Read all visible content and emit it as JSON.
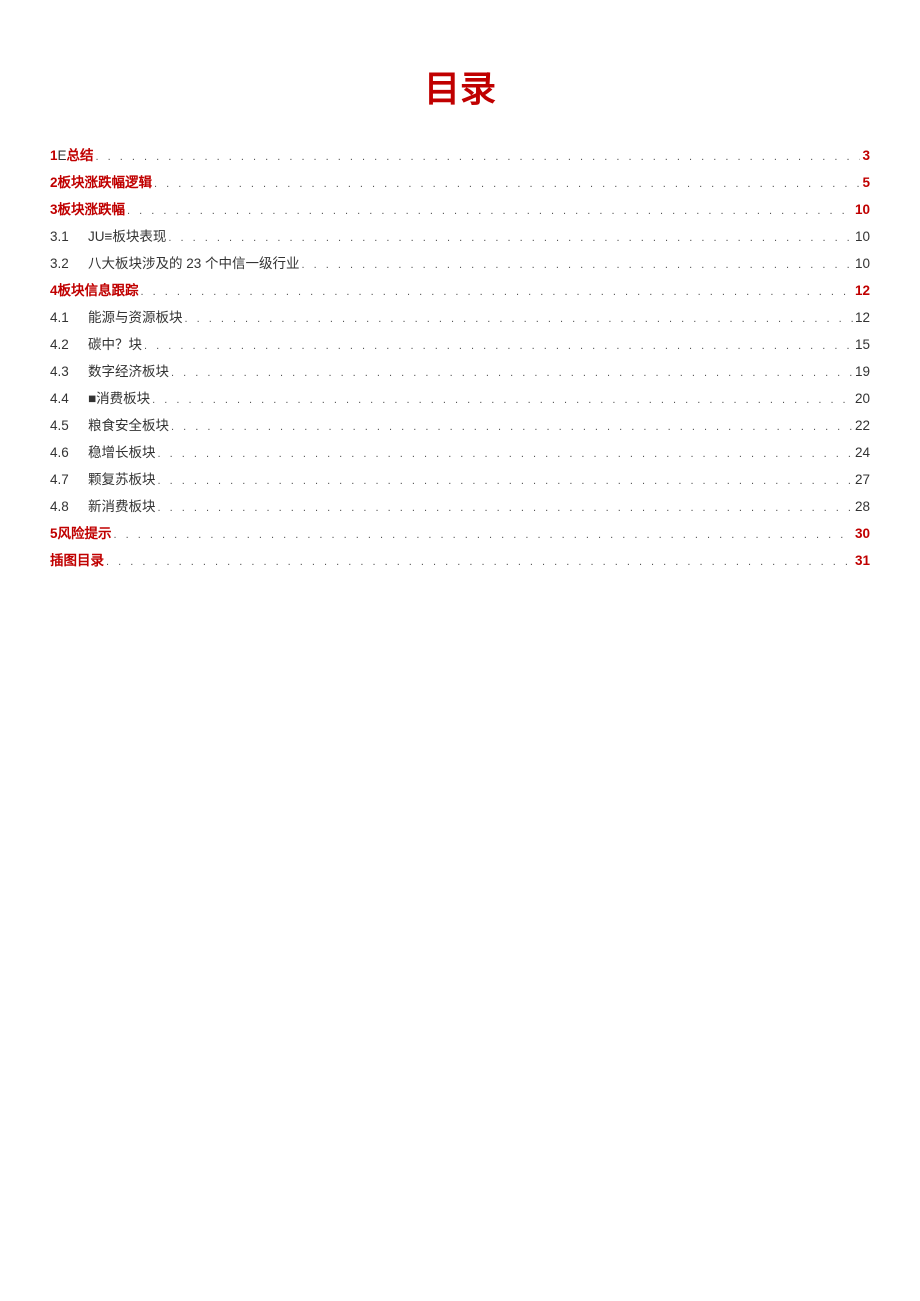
{
  "title": "目录",
  "colors": {
    "accent": "#c00000",
    "text": "#333333"
  },
  "entries": [
    {
      "level": 1,
      "num": "1",
      "numSuffix": "E",
      "text": " 总结",
      "page": "3",
      "accent": true
    },
    {
      "level": 1,
      "num": "2",
      "text": " 板块涨跌幅逻辑",
      "page": "5",
      "accent": true
    },
    {
      "level": 1,
      "num": "3",
      "text": " 板块涨跌幅",
      "page": "10",
      "accent": true
    },
    {
      "level": 2,
      "num": "3.1",
      "text": "JU≡板块表现",
      "page": "10",
      "accent": false
    },
    {
      "level": 2,
      "num": "3.2",
      "text": "八大板块涉及的 23 个中信一级行业",
      "page": "10",
      "accent": false
    },
    {
      "level": 1,
      "num": "4",
      "text": " 板块信息跟踪",
      "page": "12",
      "accent": true
    },
    {
      "level": 2,
      "num": "4.1",
      "text": "能源与资源板块",
      "page": "12",
      "accent": false
    },
    {
      "level": 2,
      "num": "4.2",
      "text": "碳中？块",
      "page": "15",
      "accent": false
    },
    {
      "level": 2,
      "num": "4.3",
      "text": "数字经济板块",
      "page": "19",
      "accent": false
    },
    {
      "level": 2,
      "num": "4.4",
      "text": "■消费板块",
      "page": "20",
      "accent": false
    },
    {
      "level": 2,
      "num": "4.5",
      "text": "粮食安全板块",
      "page": "22",
      "accent": false
    },
    {
      "level": 2,
      "num": "4.6",
      "text": "稳增长板块",
      "page": "24",
      "accent": false
    },
    {
      "level": 2,
      "num": "4.7",
      "text": "颗复苏板块",
      "page": "27",
      "accent": false
    },
    {
      "level": 2,
      "num": "4.8",
      "text": "新消费板块",
      "page": "28",
      "accent": false
    },
    {
      "level": 1,
      "num": "5",
      "text": " 风险提示",
      "page": "30",
      "accent": true
    },
    {
      "level": 0,
      "text": "插图目录",
      "page": "31",
      "accent": true
    }
  ]
}
